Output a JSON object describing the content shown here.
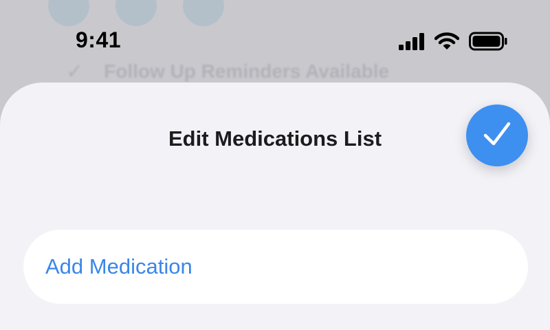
{
  "background": {
    "row_text": "Follow Up Reminders Available"
  },
  "status_bar": {
    "time": "9:41",
    "icons": [
      "cellular-signal-icon",
      "wifi-icon",
      "battery-icon"
    ]
  },
  "sheet": {
    "title": "Edit Medications List",
    "done_icon": "checkmark-icon",
    "add_medication_label": "Add Medication"
  },
  "colors": {
    "accent": "#3a86e8",
    "done_button": "#3d8ff0",
    "sheet_background": "#f2f2f7"
  }
}
